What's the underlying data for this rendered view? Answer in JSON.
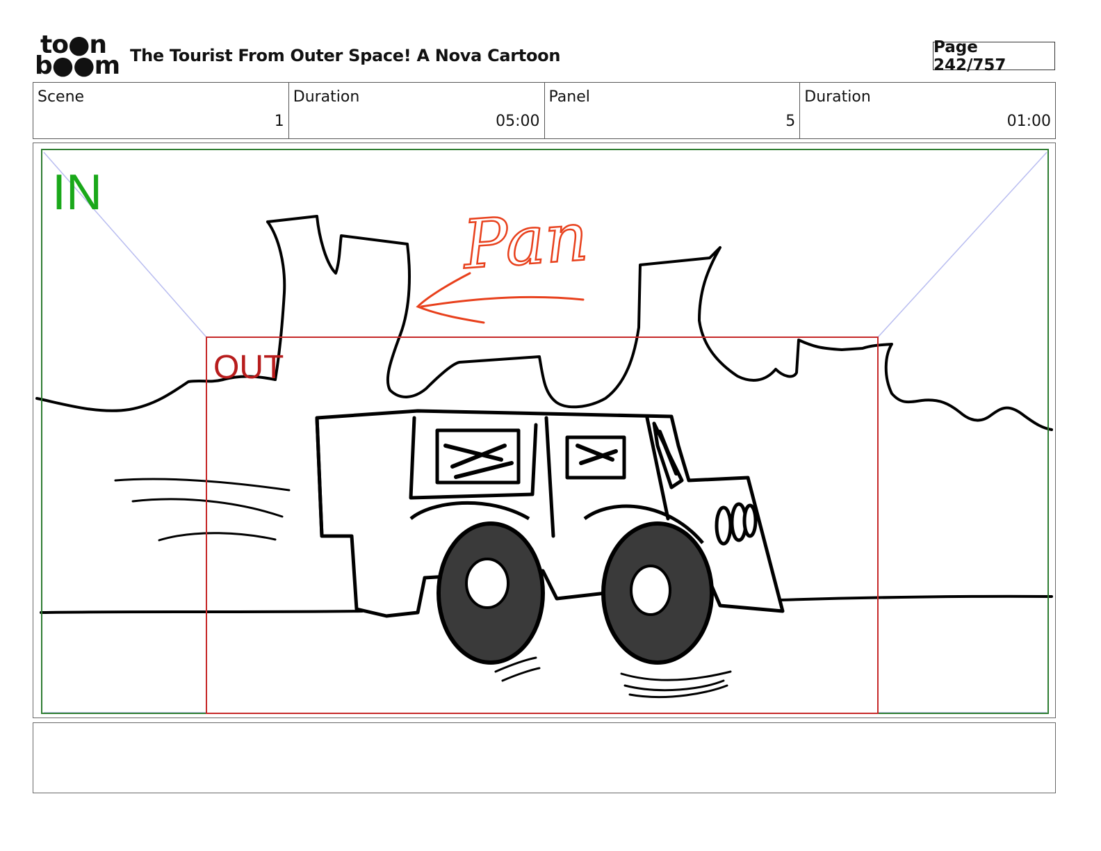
{
  "header": {
    "logo_top": "to●n",
    "logo_bottom": "b●●m",
    "title": "The Tourist From Outer Space!  A Nova Cartoon",
    "page_label": "Page 242/757"
  },
  "info": {
    "scene_label": "Scene",
    "scene_value": "1",
    "scene_duration_label": "Duration",
    "scene_duration_value": "05:00",
    "panel_label": "Panel",
    "panel_value": "5",
    "panel_duration_label": "Duration",
    "panel_duration_value": "01:00"
  },
  "panel": {
    "in_label": "IN",
    "out_label": "OUT",
    "annotation": "Pan",
    "colors": {
      "in_frame": "#2e7d32",
      "in_text": "#1aa81a",
      "out_frame": "#c62828",
      "annotation": "#e8401c",
      "guide": "#b8bcf0"
    }
  },
  "caption": {
    "text": ""
  }
}
